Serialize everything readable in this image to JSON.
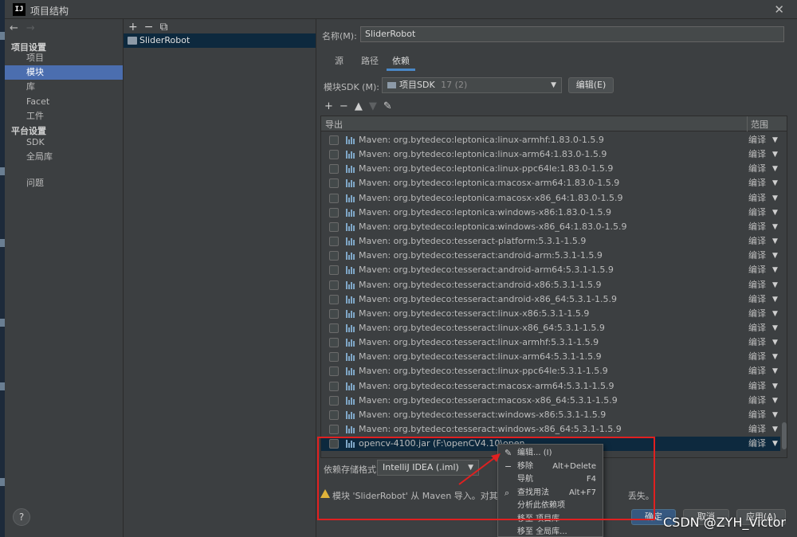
{
  "window": {
    "title": "项目结构",
    "app_icon": "IJ",
    "close_icon": "close-icon"
  },
  "nav": {
    "section_project": "项目设置",
    "items_project": [
      "项目",
      "模块",
      "库",
      "Facet",
      "工件"
    ],
    "section_platform": "平台设置",
    "items_platform": [
      "SDK",
      "全局库"
    ],
    "problems": "问题",
    "help": "?"
  },
  "modules": {
    "tools": [
      "+",
      "−",
      "⧉"
    ],
    "selected": "SliderRobot"
  },
  "detail": {
    "name_label": "名称(M):",
    "name_value": "SliderRobot",
    "tabs": [
      "源",
      "路径",
      "依赖"
    ],
    "active_tab": "依赖",
    "sdk_label": "模块SDK (M):",
    "sdk_value": "项目SDK",
    "sdk_version": "17 (2)",
    "edit_button": "编辑(E)"
  },
  "deps": {
    "header_export": "导出",
    "header_scope": "范围",
    "rows": [
      {
        "name": "Maven: org.bytedeco:leptonica:linux-armhf:1.83.0-1.5.9",
        "scope": "编译"
      },
      {
        "name": "Maven: org.bytedeco:leptonica:linux-arm64:1.83.0-1.5.9",
        "scope": "编译"
      },
      {
        "name": "Maven: org.bytedeco:leptonica:linux-ppc64le:1.83.0-1.5.9",
        "scope": "编译"
      },
      {
        "name": "Maven: org.bytedeco:leptonica:macosx-arm64:1.83.0-1.5.9",
        "scope": "编译"
      },
      {
        "name": "Maven: org.bytedeco:leptonica:macosx-x86_64:1.83.0-1.5.9",
        "scope": "编译"
      },
      {
        "name": "Maven: org.bytedeco:leptonica:windows-x86:1.83.0-1.5.9",
        "scope": "编译"
      },
      {
        "name": "Maven: org.bytedeco:leptonica:windows-x86_64:1.83.0-1.5.9",
        "scope": "编译"
      },
      {
        "name": "Maven: org.bytedeco:tesseract-platform:5.3.1-1.5.9",
        "scope": "编译"
      },
      {
        "name": "Maven: org.bytedeco:tesseract:android-arm:5.3.1-1.5.9",
        "scope": "编译"
      },
      {
        "name": "Maven: org.bytedeco:tesseract:android-arm64:5.3.1-1.5.9",
        "scope": "编译"
      },
      {
        "name": "Maven: org.bytedeco:tesseract:android-x86:5.3.1-1.5.9",
        "scope": "编译"
      },
      {
        "name": "Maven: org.bytedeco:tesseract:android-x86_64:5.3.1-1.5.9",
        "scope": "编译"
      },
      {
        "name": "Maven: org.bytedeco:tesseract:linux-x86:5.3.1-1.5.9",
        "scope": "编译"
      },
      {
        "name": "Maven: org.bytedeco:tesseract:linux-x86_64:5.3.1-1.5.9",
        "scope": "编译"
      },
      {
        "name": "Maven: org.bytedeco:tesseract:linux-armhf:5.3.1-1.5.9",
        "scope": "编译"
      },
      {
        "name": "Maven: org.bytedeco:tesseract:linux-arm64:5.3.1-1.5.9",
        "scope": "编译"
      },
      {
        "name": "Maven: org.bytedeco:tesseract:linux-ppc64le:5.3.1-1.5.9",
        "scope": "编译"
      },
      {
        "name": "Maven: org.bytedeco:tesseract:macosx-arm64:5.3.1-1.5.9",
        "scope": "编译"
      },
      {
        "name": "Maven: org.bytedeco:tesseract:macosx-x86_64:5.3.1-1.5.9",
        "scope": "编译"
      },
      {
        "name": "Maven: org.bytedeco:tesseract:windows-x86:5.3.1-1.5.9",
        "scope": "编译"
      },
      {
        "name": "Maven: org.bytedeco:tesseract:windows-x86_64:5.3.1-1.5.9",
        "scope": "编译"
      },
      {
        "name": "opencv-4100.jar (F:\\openCV4.10\\open",
        "scope": "编译",
        "selected": true
      }
    ]
  },
  "storage": {
    "label": "依赖存储格式:",
    "value": "IntelliJ IDEA (.iml)"
  },
  "warning": {
    "text": "模块 'SliderRobot' 从 Maven 导入。对其配置做",
    "text_tail": "丢失。"
  },
  "buttons": {
    "ok": "确定",
    "cancel": "取消",
    "apply": "应用(A)"
  },
  "context_menu": [
    {
      "icon": "pencil-icon",
      "label": "编辑... (I)",
      "shortcut": ""
    },
    {
      "icon": "minus-icon",
      "label": "移除",
      "shortcut": "Alt+Delete"
    },
    {
      "icon": "",
      "label": "导航",
      "shortcut": "F4"
    },
    {
      "icon": "search-icon",
      "label": "查找用法",
      "shortcut": "Alt+F7"
    },
    {
      "icon": "",
      "label": "分析此依赖项",
      "shortcut": ""
    },
    {
      "icon": "",
      "label": "移至 项目库",
      "shortcut": ""
    },
    {
      "icon": "",
      "label": "移至 全局库...",
      "shortcut": ""
    }
  ],
  "watermark": "CSDN @ZYH_Victor",
  "colors": {
    "selection": "#4b6eaf",
    "dark_selection": "#0d293e",
    "annotation": "#e02020",
    "accent": "#4a88c7"
  }
}
